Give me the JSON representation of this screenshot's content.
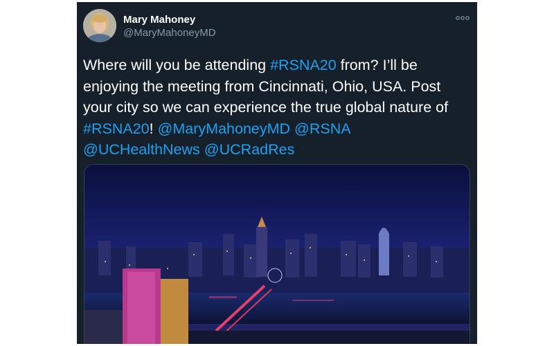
{
  "tweet": {
    "author": {
      "name": "Mary Mahoney",
      "handle": "@MaryMahoneyMD"
    },
    "text_parts": {
      "p1": "Where will you be attending ",
      "hashtag1": "#RSNA20",
      "p2": " from? I’ll be enjoying the meeting from Cincinnati, Ohio, USA. Post your city so we can experience the true global nature of ",
      "hashtag2": "#RSNA20",
      "p3": "! ",
      "mention1": "@MaryMahoneyMD",
      "mention2": "@RSNA",
      "mention3": "@UCHealthNews",
      "mention4": "@UCRadRes"
    },
    "more_icon": "ellipsis-icon",
    "media_subject": "Cincinnati skyline at night"
  },
  "colors": {
    "background": "#15202b",
    "text": "#ffffff",
    "secondary_text": "#8899a6",
    "link": "#1da1f2",
    "border": "#38444d"
  }
}
